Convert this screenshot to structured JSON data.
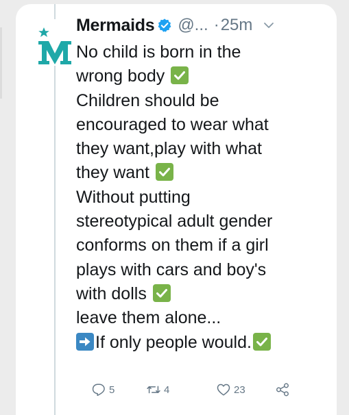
{
  "tweet": {
    "author_name": "Mermaids",
    "handle": "@...",
    "separator": "·",
    "time": "25m",
    "lines": [
      {
        "text": "No child is born in the",
        "emoji": null
      },
      {
        "text": "wrong body ",
        "emoji": "check"
      },
      {
        "text": "Children should be",
        "emoji": null
      },
      {
        "text": "encouraged to wear what",
        "emoji": null
      },
      {
        "text": "they want,play with what",
        "emoji": null
      },
      {
        "text": "they want ",
        "emoji": "check"
      },
      {
        "text": "Without putting",
        "emoji": null
      },
      {
        "text": "stereotypical adult gender",
        "emoji": null
      },
      {
        "text": "conforms on them if a girl",
        "emoji": null
      },
      {
        "text": "plays with cars and boy's",
        "emoji": null
      },
      {
        "text": "with dolls ",
        "emoji": "check"
      },
      {
        "text": "leave them alone...",
        "emoji": null
      },
      {
        "text": "If only people would.",
        "emoji": "check",
        "lead_emoji": "arrow"
      }
    ],
    "actions": {
      "replies": "5",
      "retweets": "4",
      "likes": "23"
    }
  },
  "icons": {
    "avatar": "mermaids-logo-icon",
    "verified": "verified-badge-icon",
    "caret": "chevron-down-icon",
    "reply": "reply-icon",
    "retweet": "retweet-icon",
    "like": "heart-icon",
    "share": "share-icon",
    "check_emoji": "check-mark-emoji-icon",
    "arrow_emoji": "right-arrow-emoji-icon"
  },
  "colors": {
    "brand_teal": "#1fa8a8",
    "verified_blue": "#1da1f2",
    "check_green": "#79b349",
    "arrow_blue": "#3b88c3",
    "text_primary": "#14171a",
    "text_secondary": "#657786"
  }
}
